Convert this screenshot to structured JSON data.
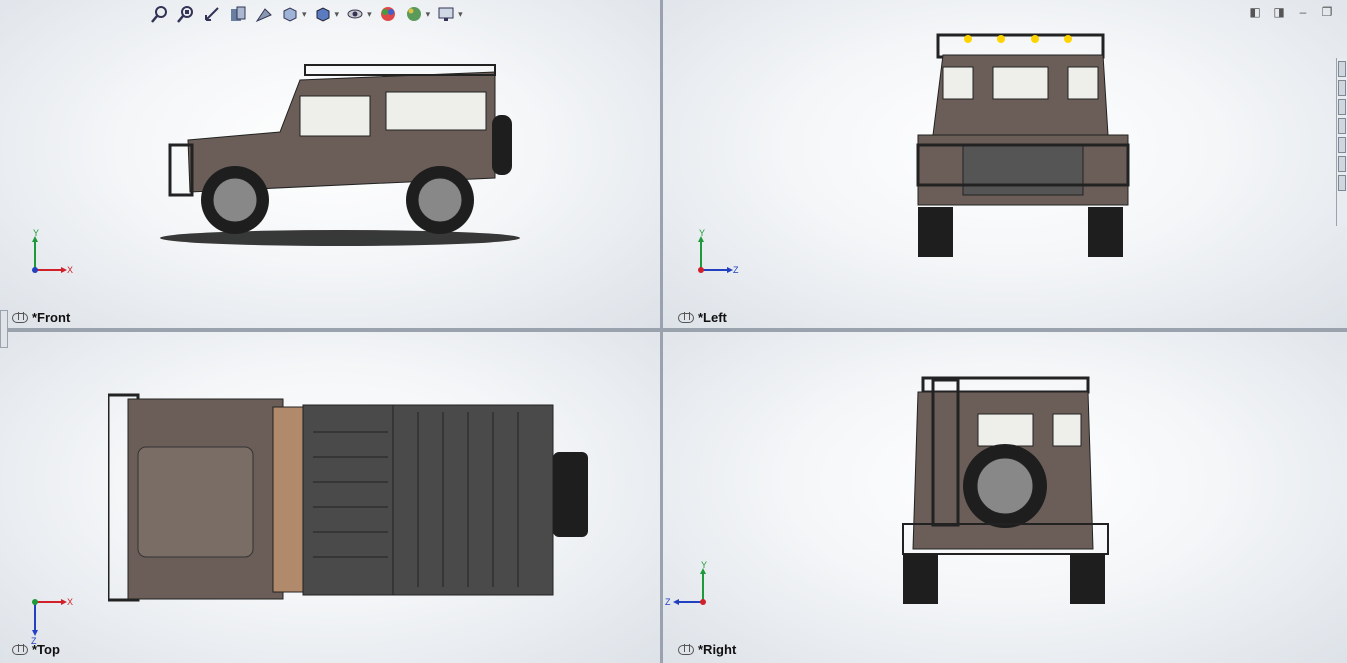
{
  "viewports": {
    "front": {
      "label": "*Front",
      "h_axis": "X",
      "v_axis": "Y"
    },
    "left": {
      "label": "*Left",
      "h_axis": "Z",
      "v_axis": "Y"
    },
    "top": {
      "label": "*Top",
      "h_axis": "X",
      "v_axis": "Z"
    },
    "right": {
      "label": "*Right",
      "h_axis": "Z",
      "v_axis": "Y"
    }
  },
  "toolbar": {
    "icons": [
      "zoom-to-fit-icon",
      "zoom-area-icon",
      "previous-view-icon",
      "section-view-icon",
      "dynamic-annotation-icon",
      "view-orientation-icon",
      "display-style-icon",
      "hide-show-icon",
      "edit-appearance-icon",
      "apply-scene-icon",
      "view-settings-icon"
    ]
  },
  "window_controls": [
    "tile-left-icon",
    "tile-right-icon",
    "minimize-icon",
    "restore-icon"
  ],
  "colors": {
    "body": "#6b5e58",
    "tire": "#1e1e1e",
    "axis_x": "#d0202a",
    "axis_y": "#1e9a3a",
    "axis_z": "#2340c0"
  }
}
